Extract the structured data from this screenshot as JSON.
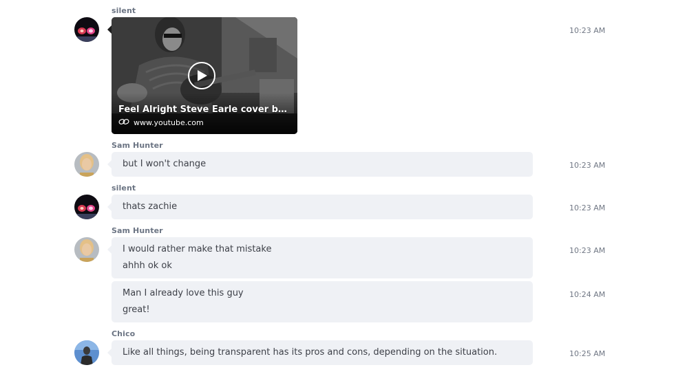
{
  "messages": [
    {
      "sender": "silent",
      "time": "10:23 AM",
      "video": {
        "title": "Feel Alright   Steve Earle cover by The...",
        "link_icon": "link-icon",
        "domain": "www.youtube.com",
        "play_icon": "play-icon"
      }
    },
    {
      "sender": "Sam Hunter",
      "lines": [
        "but I won't change"
      ],
      "time": "10:23 AM"
    },
    {
      "sender": "silent",
      "lines": [
        "thats zachie"
      ],
      "time": "10:23 AM"
    },
    {
      "sender": "Sam Hunter",
      "lines": [
        "I would rather make that mistake",
        "ahhh ok ok"
      ],
      "time": "10:23 AM"
    },
    {
      "sender": "",
      "lines": [
        "Man I already love this guy",
        "great!"
      ],
      "time": "10:24 AM"
    },
    {
      "sender": "Chico",
      "lines": [
        "Like all things, being transparent has its pros and cons, depending on the situation."
      ],
      "time": "10:25 AM"
    }
  ],
  "colors": {
    "bubble": "#eff1f5",
    "sender": "#6b7483",
    "time": "#707784",
    "text": "#3d4048"
  }
}
